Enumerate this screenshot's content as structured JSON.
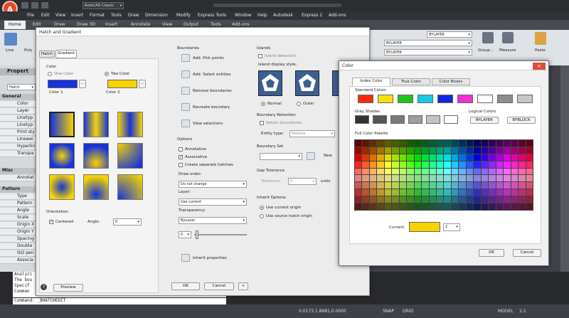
{
  "app": {
    "logo": "A",
    "workspace": "AutoCAD Classic"
  },
  "menubar": [
    "File",
    "Edit",
    "View",
    "Insert",
    "Format",
    "Tools",
    "Draw",
    "Dimension",
    "Modify",
    "Express Tools",
    "Window",
    "Help",
    "Autodesk",
    "Express 2",
    "Add-ons"
  ],
  "ribbon_tabs": [
    {
      "label": "Home",
      "active": true
    },
    {
      "label": "Edit"
    },
    {
      "label": "Draw"
    },
    {
      "label": "Draw 3D"
    },
    {
      "label": "Insert"
    },
    {
      "label": "Annotate"
    },
    {
      "label": "View"
    },
    {
      "label": "Output"
    },
    {
      "label": "Tools"
    },
    {
      "label": "Add-ons"
    }
  ],
  "ribbon": {
    "line": "Line",
    "poly": "Poly",
    "layers": [
      "BYLAYER",
      "BYLAYER",
      "BYLAYER"
    ],
    "group": "Group...",
    "measure": "Measure",
    "paste": "Paste"
  },
  "properties_panel": {
    "title": "Propert",
    "selector": "Hatch",
    "rows": [
      {
        "label": "General",
        "header": true
      },
      {
        "label": "Color"
      },
      {
        "label": "Layer"
      },
      {
        "label": "Linetyp"
      },
      {
        "label": "Linetyp"
      },
      {
        "label": "Print sty"
      },
      {
        "label": "Linewei"
      },
      {
        "label": "Hyperlin"
      },
      {
        "label": "Transpa"
      },
      {
        "label": "Misc",
        "header": true
      },
      {
        "label": "Annotat"
      },
      {
        "label": "Pattern",
        "header": true
      },
      {
        "label": "Type"
      },
      {
        "label": "Pattern"
      },
      {
        "label": "Angle"
      },
      {
        "label": "Scale"
      },
      {
        "label": "Origin X"
      },
      {
        "label": "Origin Y"
      },
      {
        "label": "Spacing"
      },
      {
        "label": "Double"
      },
      {
        "label": "ISO pen"
      },
      {
        "label": "Associa"
      }
    ]
  },
  "command_lines": [
    "Analyzi",
    "The bou",
    "Specif",
    "Comman"
  ],
  "command_prompt": "Command: _BHATCHEDIT",
  "status": {
    "coords": "0.0173,1.8681,0.0000",
    "model": "MODEL",
    "scale": "1:1",
    "snap": "SNAP",
    "grid": "GRID"
  },
  "hatch_dialog": {
    "title": "Hatch and Gradient",
    "tabs": [
      "Hatch",
      "Gradient"
    ],
    "color_section": "Color",
    "one_color": "One Color",
    "two_color": "Two Color",
    "color1_label": "Color 1",
    "color2_label": "Color 2",
    "color1": "#1733d9",
    "color2": "#f5d400",
    "orientation": "Orientation",
    "centered": "Centered",
    "angle_label": "Angle:",
    "angle_value": "0",
    "preview": "Preview",
    "boundaries": "Boundaries",
    "boundary_buttons": [
      "Add: Pick points",
      "Add: Select entities",
      "Remove boundaries",
      "Recreate boundary",
      "View selections"
    ],
    "options": "Options",
    "annotative": "Annotative",
    "associative": "Associative",
    "create_separate": "Create separate hatches",
    "draw_order": "Draw order:",
    "draw_order_value": "Do not change",
    "layer": "Layer:",
    "layer_value": "Use current",
    "transparency": "Transparency:",
    "transparency_value": "ByLayer",
    "transparency_number": "0",
    "inherit": "Inherit properties",
    "islands": "Islands",
    "island_detection": "Island detection",
    "island_style": "Island display style:",
    "normal": "Normal",
    "outer": "Outer",
    "boundary_retention": "Boundary Retention",
    "retain": "Retain boundaries",
    "entity_type": "Entity type:",
    "entity_type_value": "Polyline",
    "boundary_set": "Boundary Set",
    "new": "New",
    "gap_tolerance": "Gap Tolerance",
    "tolerance": "Tolerance:",
    "tolerance_value": "0",
    "units": "units",
    "inherit_options": "Inherit Options",
    "use_current_origin": "Use current origin",
    "use_source_origin": "Use source hatch origin",
    "ok": "OK",
    "cancel": "Cancel",
    "more": "<"
  },
  "color_dialog": {
    "title": "Color",
    "tabs": [
      "Index Color",
      "True Color",
      "Color Books"
    ],
    "standard_colors": "Standard Colors",
    "standard": [
      "#ff2a0a",
      "#f5e200",
      "#1fc41f",
      "#16c8ec",
      "#1026e0",
      "#ee30d8",
      "#ffffff",
      "#8c8c8c",
      "#c6c6c6"
    ],
    "gray_shades": "Gray Shades",
    "grays": [
      "#333333",
      "#555555",
      "#7a7a7a",
      "#9d9d9d",
      "#c4c4c4",
      "#ffffff"
    ],
    "logical_colors": "Logical Colors",
    "bylayer": "BYLAYER",
    "byblock": "BYBLOCK",
    "full_palette": "Full Color Palette",
    "current": "Current:",
    "current_color": "#f5d400",
    "current_value": "2",
    "ok": "OK",
    "cancel": "Cancel",
    "close": "×"
  }
}
